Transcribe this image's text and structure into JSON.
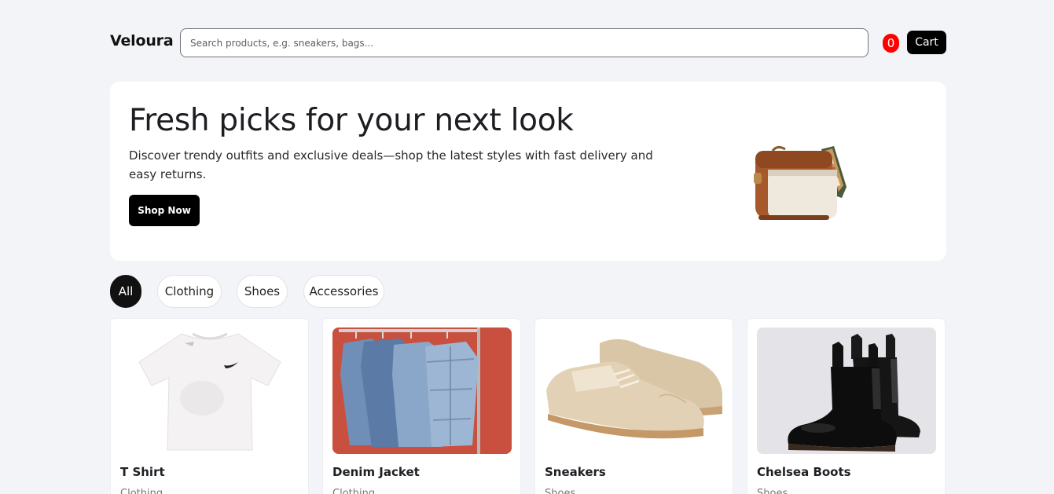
{
  "header": {
    "brand": "Veloura",
    "search_placeholder": "Search products, e.g. sneakers, bags...",
    "cart_count": "0",
    "cart_label": "Cart"
  },
  "hero": {
    "title": "Fresh picks for your next look",
    "subtitle": "Discover trendy outfits and exclusive deals—shop the latest styles with fast delivery and easy returns.",
    "cta_label": "Shop Now"
  },
  "filters": [
    "All",
    "Clothing",
    "Shoes",
    "Accessories"
  ],
  "active_filter": "All",
  "products": [
    {
      "name": "T Shirt",
      "category": "Clothing"
    },
    {
      "name": "Denim Jacket",
      "category": "Clothing"
    },
    {
      "name": "Sneakers",
      "category": "Shoes"
    },
    {
      "name": "Chelsea Boots",
      "category": "Shoes"
    }
  ],
  "colors": {
    "accent": "#000000",
    "badge": "#ff0000",
    "background": "#f3f4f7"
  }
}
